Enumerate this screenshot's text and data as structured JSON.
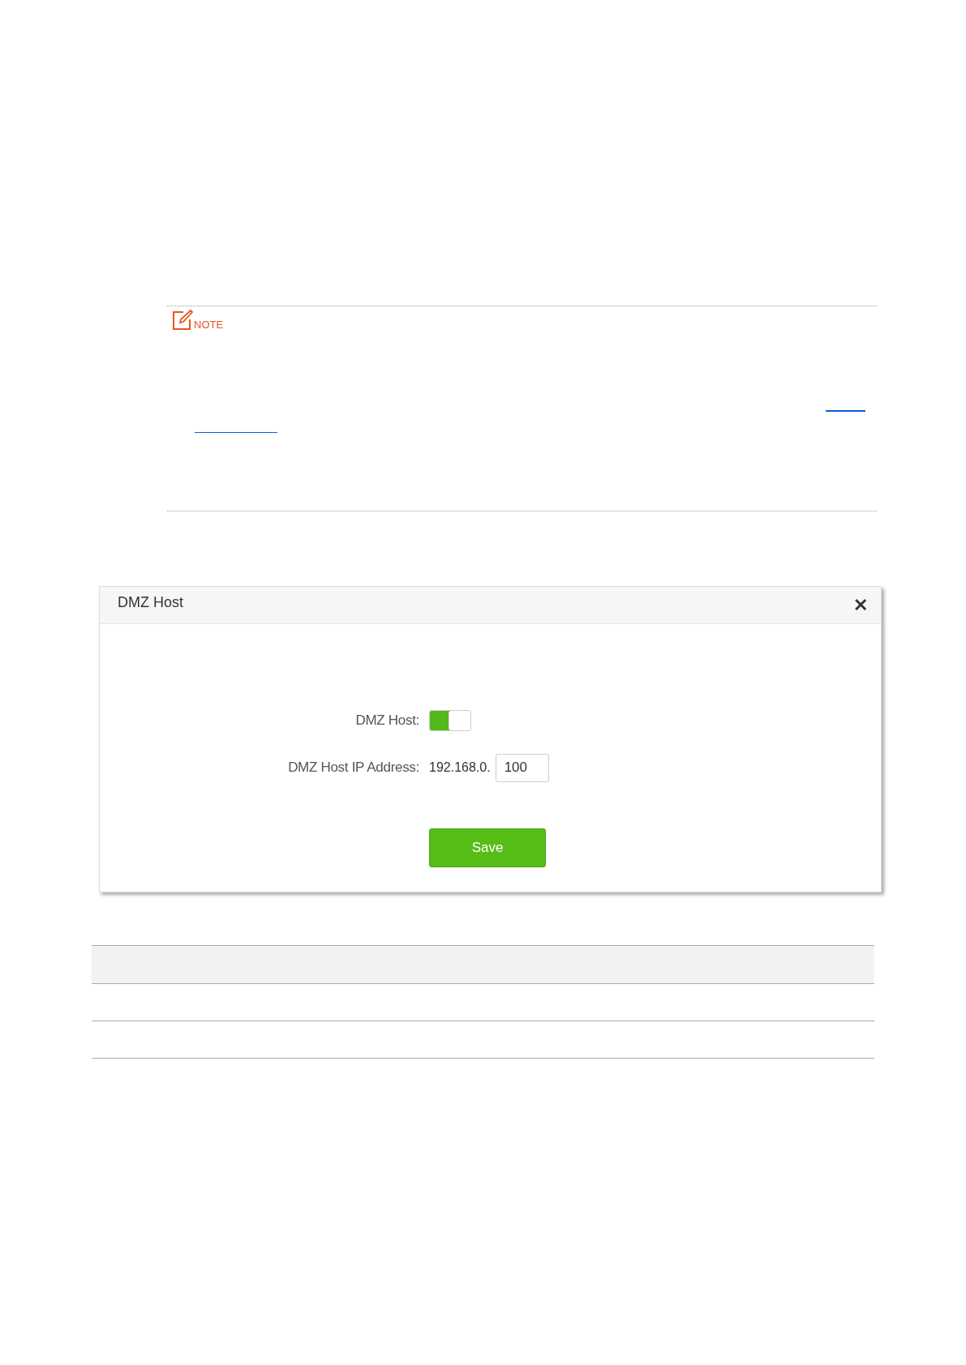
{
  "note": {
    "label": "NOTE"
  },
  "dialog": {
    "title": "DMZ Host",
    "close": "✕",
    "fields": [
      {
        "kind": "toggle",
        "label": "DMZ Host:",
        "on": true
      },
      {
        "kind": "ip",
        "label": "DMZ Host IP Address:",
        "prefix": "192.168.0.",
        "value": "100"
      }
    ],
    "save": "Save"
  }
}
